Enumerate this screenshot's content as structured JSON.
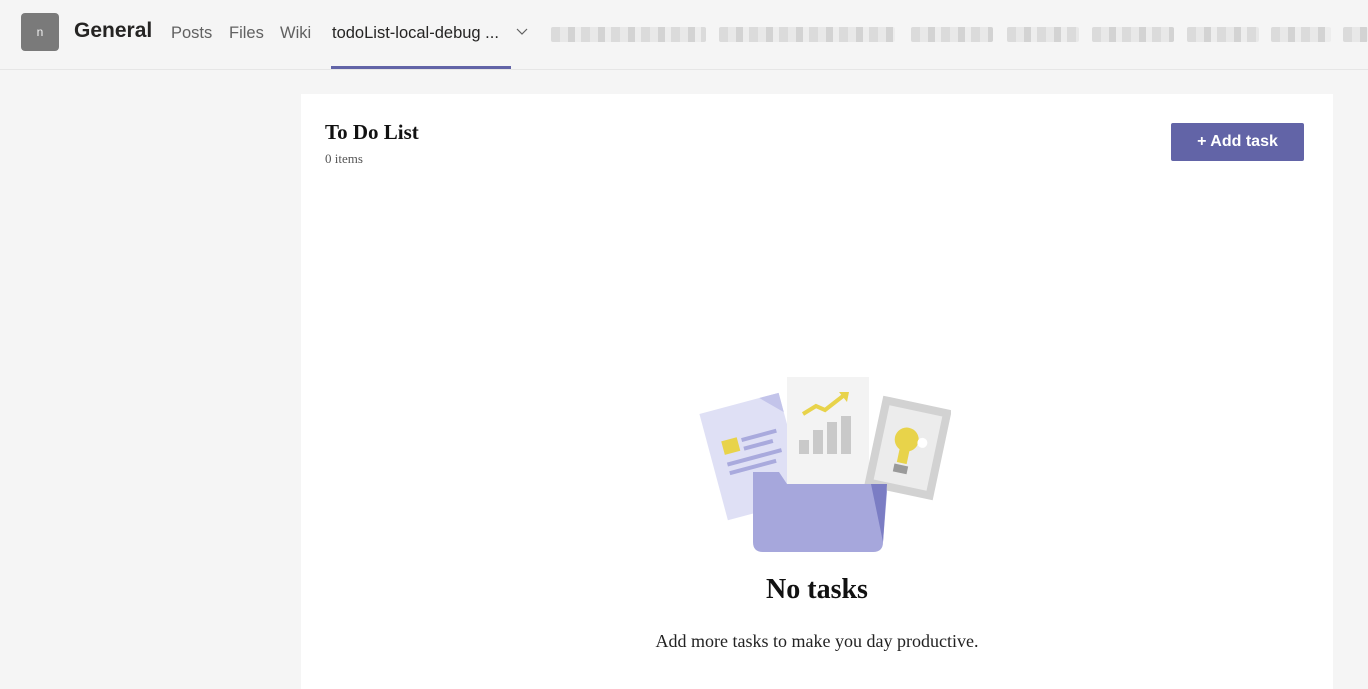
{
  "header": {
    "avatar_letter": "n",
    "channel_title": "General",
    "tabs": [
      {
        "label": "Posts"
      },
      {
        "label": "Files"
      },
      {
        "label": "Wiki"
      },
      {
        "label": "todoList-local-debug ..."
      }
    ]
  },
  "todo": {
    "title": "To Do List",
    "count_text": "0 items",
    "add_button_label": "+ Add task",
    "empty_title": "No tasks",
    "empty_subtitle": "Add more tasks to make you day productive."
  },
  "colors": {
    "accent": "#6264a7",
    "background": "#f5f5f5",
    "card": "#ffffff"
  }
}
